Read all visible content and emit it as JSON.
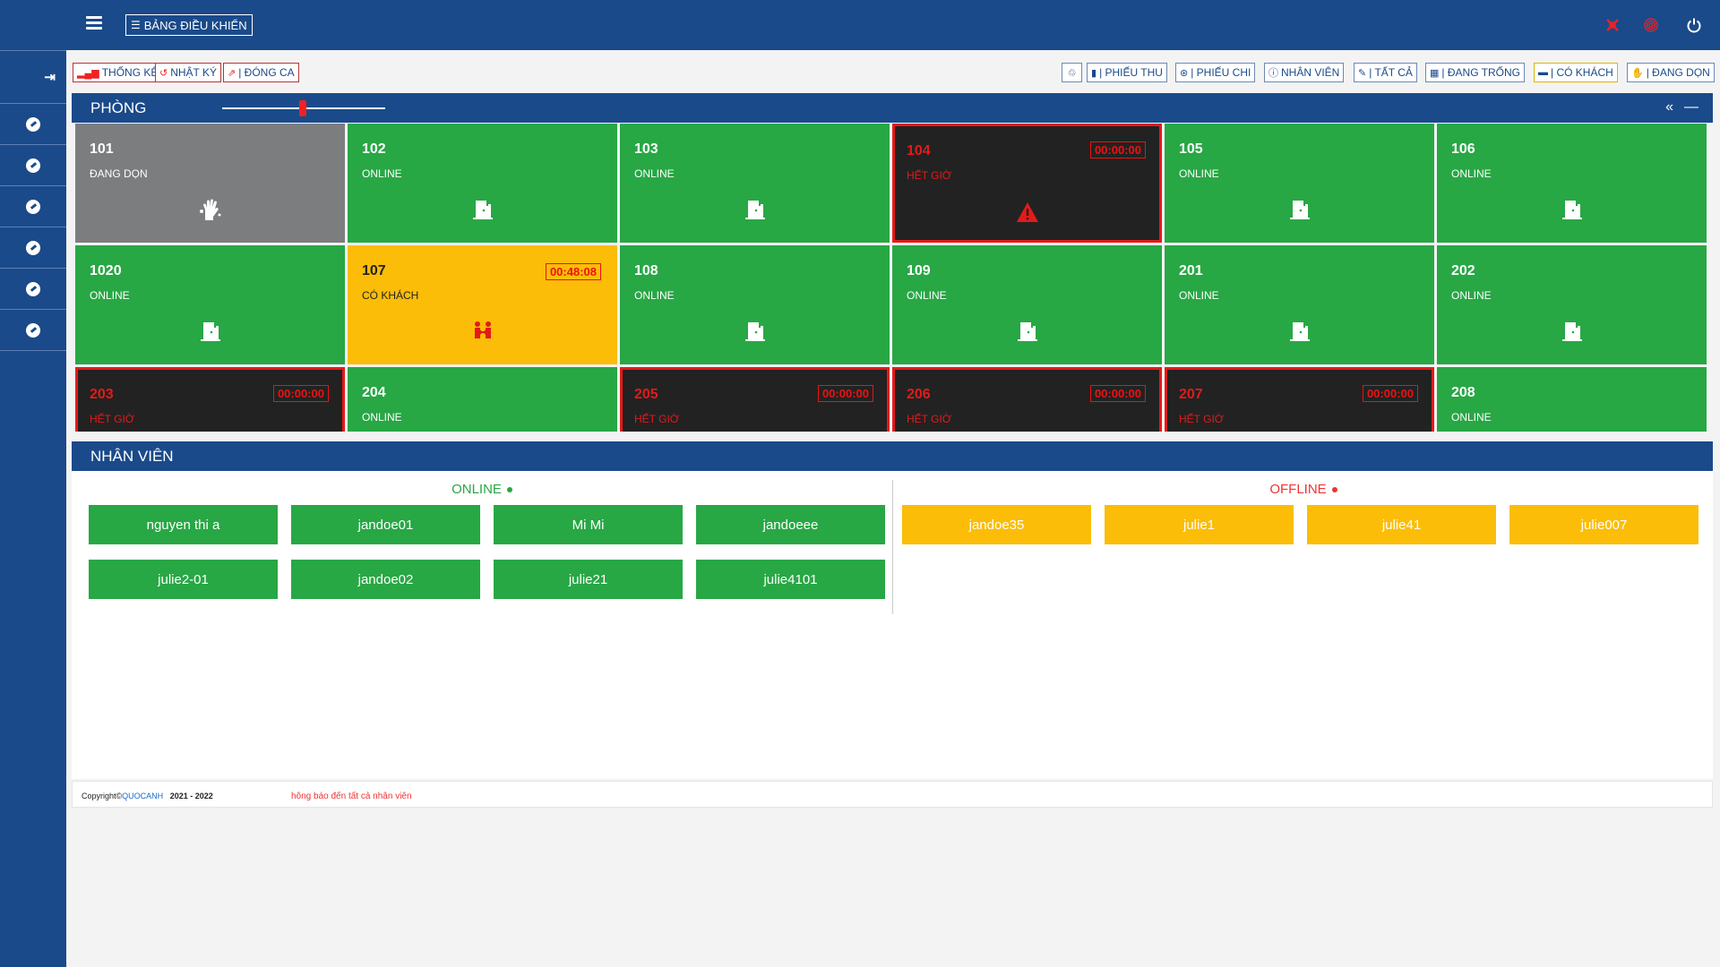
{
  "header": {
    "dashboard_label": "BẢNG ĐIỀU KHIỂN",
    "right_icons": [
      "close-x-icon",
      "fingerprint-icon",
      "power-icon"
    ],
    "accent_color": "#1a4a8a"
  },
  "sidebar": {
    "items": [
      "logout-icon",
      "compass-icon",
      "compass-icon",
      "compass-icon",
      "compass-icon",
      "compass-icon",
      "compass-icon"
    ]
  },
  "toolbar": {
    "left": [
      {
        "label": "THỐNG KÊ",
        "icon": "signal-icon"
      },
      {
        "label": "NHẬT KÝ",
        "icon": "history-icon"
      },
      {
        "label": "| ĐÓNG CA",
        "icon": "shift-close-icon"
      }
    ],
    "right": [
      {
        "label": "",
        "icon": "recycle-icon"
      },
      {
        "label": "| PHIẾU THU",
        "icon": "receipt-icon"
      },
      {
        "label": "| PHIẾU CHI",
        "icon": "payment-icon"
      },
      {
        "label": "NHÂN VIÊN",
        "icon": "staff-icon"
      },
      {
        "label": "| TẤT CẢ",
        "icon": "all-icon"
      },
      {
        "label": "| ĐANG TRỐNG",
        "icon": "vacant-icon"
      },
      {
        "label": "| CÓ KHÁCH",
        "icon": "bed-icon"
      },
      {
        "label": "| ĐANG DỌN",
        "icon": "cleaning-icon"
      }
    ]
  },
  "rooms_section": {
    "title": "PHÒNG",
    "zoom_level": 0.5,
    "rooms": [
      {
        "number": "101",
        "status": "ĐANG DỌN",
        "state": "cleaning",
        "timer": "",
        "icon": "cleaning-hand-icon"
      },
      {
        "number": "102",
        "status": "ONLINE",
        "state": "online",
        "timer": "",
        "icon": "door-icon"
      },
      {
        "number": "103",
        "status": "ONLINE",
        "state": "online",
        "timer": "",
        "icon": "door-icon"
      },
      {
        "number": "104",
        "status": "HẾT GIỜ",
        "state": "expired",
        "timer": "00:00:00",
        "icon": "warning-icon"
      },
      {
        "number": "105",
        "status": "ONLINE",
        "state": "online",
        "timer": "",
        "icon": "door-icon"
      },
      {
        "number": "106",
        "status": "ONLINE",
        "state": "online",
        "timer": "",
        "icon": "door-icon"
      },
      {
        "number": "1020",
        "status": "ONLINE",
        "state": "online",
        "timer": "",
        "icon": "door-icon"
      },
      {
        "number": "107",
        "status": "CÓ KHÁCH",
        "state": "guest",
        "timer": "00:48:08",
        "icon": "guests-icon"
      },
      {
        "number": "108",
        "status": "ONLINE",
        "state": "online",
        "timer": "",
        "icon": "door-icon"
      },
      {
        "number": "109",
        "status": "ONLINE",
        "state": "online",
        "timer": "",
        "icon": "door-icon"
      },
      {
        "number": "201",
        "status": "ONLINE",
        "state": "online",
        "timer": "",
        "icon": "door-icon"
      },
      {
        "number": "202",
        "status": "ONLINE",
        "state": "online",
        "timer": "",
        "icon": "door-icon"
      },
      {
        "number": "203",
        "status": "HẾT GIỜ",
        "state": "expired",
        "timer": "00:00:00",
        "icon": "warning-icon"
      },
      {
        "number": "204",
        "status": "ONLINE",
        "state": "online",
        "timer": "",
        "icon": "door-icon"
      },
      {
        "number": "205",
        "status": "HẾT GIỜ",
        "state": "expired",
        "timer": "00:00:00",
        "icon": "warning-icon"
      },
      {
        "number": "206",
        "status": "HẾT GIỜ",
        "state": "expired",
        "timer": "00:00:00",
        "icon": "warning-icon"
      },
      {
        "number": "207",
        "status": "HẾT GIỜ",
        "state": "expired",
        "timer": "00:00:00",
        "icon": "warning-icon"
      },
      {
        "number": "208",
        "status": "ONLINE",
        "state": "online",
        "timer": "",
        "icon": "door-icon"
      }
    ]
  },
  "staff_section": {
    "title": "NHÂN VIÊN",
    "online_title": "ONLINE",
    "offline_title": "OFFLINE",
    "online": [
      "nguyen thi a",
      "jandoe01",
      "Mi Mi",
      "jandoeee",
      "julie2-01",
      "jandoe02",
      "julie21",
      "julie4101"
    ],
    "offline": [
      "jandoe35",
      "julie1",
      "julie41",
      "julie007"
    ]
  },
  "footer": {
    "copyright_prefix": "Copyright©",
    "brand": "QUOCANH",
    "years": "2021 - 2022",
    "notice": "hông báo đến tất cả nhân viên"
  },
  "colors": {
    "online": "#28a745",
    "guest": "#fbbd08",
    "cleaning": "#7b7d7f",
    "expired": "#222222",
    "alert": "#e41a1a"
  }
}
